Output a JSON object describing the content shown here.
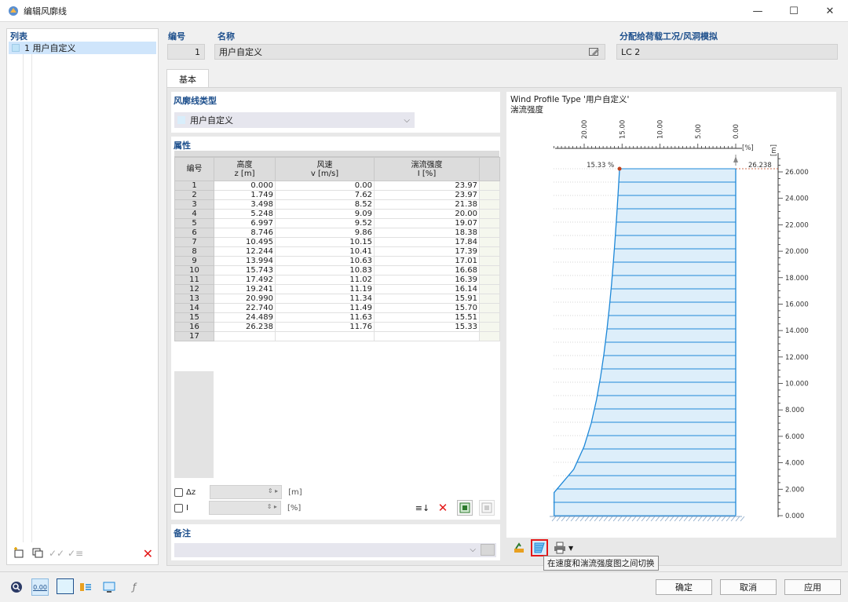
{
  "window": {
    "title": "编辑风廓线",
    "min_icon": "—",
    "max_icon": "☐",
    "close_icon": "✕"
  },
  "list": {
    "header": "列表",
    "items": [
      {
        "label": "1 用户自定义"
      }
    ]
  },
  "header": {
    "no_label": "编号",
    "no_value": "1",
    "name_label": "名称",
    "name_value": "用户自定义",
    "assign_label": "分配给荷载工况/风洞模拟",
    "assign_value": "LC 2"
  },
  "tabs": [
    {
      "label": "基本"
    }
  ],
  "profile_type": {
    "title": "风廓线类型",
    "selected": "用户自定义"
  },
  "properties": {
    "title": "属性",
    "columns": {
      "no": "编号",
      "height": "高度",
      "height_unit": "z [m]",
      "speed": "风速",
      "speed_unit": "v [m/s]",
      "turb": "湍流强度",
      "turb_unit": "I [%]"
    },
    "rows": [
      [
        "1",
        "0.000",
        "0.00",
        "23.97"
      ],
      [
        "2",
        "1.749",
        "7.62",
        "23.97"
      ],
      [
        "3",
        "3.498",
        "8.52",
        "21.38"
      ],
      [
        "4",
        "5.248",
        "9.09",
        "20.00"
      ],
      [
        "5",
        "6.997",
        "9.52",
        "19.07"
      ],
      [
        "6",
        "8.746",
        "9.86",
        "18.38"
      ],
      [
        "7",
        "10.495",
        "10.15",
        "17.84"
      ],
      [
        "8",
        "12.244",
        "10.41",
        "17.39"
      ],
      [
        "9",
        "13.994",
        "10.63",
        "17.01"
      ],
      [
        "10",
        "15.743",
        "10.83",
        "16.68"
      ],
      [
        "11",
        "17.492",
        "11.02",
        "16.39"
      ],
      [
        "12",
        "19.241",
        "11.19",
        "16.14"
      ],
      [
        "13",
        "20.990",
        "11.34",
        "15.91"
      ],
      [
        "14",
        "22.740",
        "11.49",
        "15.70"
      ],
      [
        "15",
        "24.489",
        "11.63",
        "15.51"
      ],
      [
        "16",
        "26.238",
        "11.76",
        "15.33"
      ],
      [
        "17",
        "",
        "",
        ""
      ]
    ]
  },
  "options": {
    "dz_label": "Δz",
    "dz_unit": "[m]",
    "i_label": "I",
    "i_unit": "[%]"
  },
  "notes": {
    "title": "备注"
  },
  "chart": {
    "title": "Wind Profile Type '用户自定义'",
    "subtitle": "湍流强度",
    "x_ticks": [
      "20.00",
      "15.00",
      "10.00",
      "5.00",
      "0.00"
    ],
    "x_unit": "[%]",
    "y_unit": "[m]",
    "y_ticks": [
      "26.000",
      "24.000",
      "22.000",
      "20.000",
      "18.000",
      "16.000",
      "14.000",
      "12.000",
      "10.000",
      "8.000",
      "6.000",
      "4.000",
      "2.000",
      "0.000"
    ],
    "top_value_label": "15.33 %",
    "top_height_label": "26.238",
    "fill_color": "#ddeefa",
    "line_color": "#1e88d8",
    "marker_color": "#c0401a"
  },
  "chart_data": {
    "type": "line",
    "title": "Wind Profile Type '用户自定义'",
    "subtitle": "湍流强度",
    "xlabel": "[%]",
    "ylabel": "[m]",
    "xlim": [
      0,
      25
    ],
    "ylim": [
      0,
      26.238
    ],
    "series": [
      {
        "name": "湍流强度",
        "x": [
          23.97,
          23.97,
          21.38,
          20.0,
          19.07,
          18.38,
          17.84,
          17.39,
          17.01,
          16.68,
          16.39,
          16.14,
          15.91,
          15.7,
          15.51,
          15.33
        ],
        "y": [
          0.0,
          1.749,
          3.498,
          5.248,
          6.997,
          8.746,
          10.495,
          12.244,
          13.994,
          15.743,
          17.492,
          19.241,
          20.99,
          22.74,
          24.489,
          26.238
        ]
      }
    ]
  },
  "chart_toolbar": {
    "tooltip": "在速度和湍流强度图之间切换"
  },
  "buttons": {
    "ok": "确定",
    "cancel": "取消",
    "apply": "应用"
  },
  "bottom_icons": {
    "value_icon_text": "0.00"
  }
}
